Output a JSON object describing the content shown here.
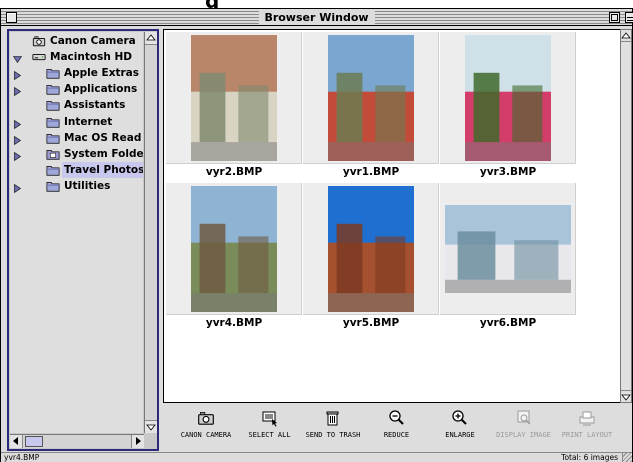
{
  "window": {
    "title": "Browser Window"
  },
  "tree": {
    "items": [
      {
        "label": "Canon Camera",
        "icon": "camera-icon",
        "expander": "none"
      },
      {
        "label": "Macintosh HD",
        "icon": "hard-disk-icon",
        "expander": "down"
      },
      {
        "label": "Apple Extras",
        "icon": "folder-icon",
        "expander": "right"
      },
      {
        "label": "Applications",
        "icon": "folder-icon",
        "expander": "right"
      },
      {
        "label": "Assistants",
        "icon": "folder-icon",
        "expander": "none"
      },
      {
        "label": "Internet",
        "icon": "folder-icon",
        "expander": "right"
      },
      {
        "label": "Mac OS Read Me",
        "icon": "folder-icon",
        "expander": "right"
      },
      {
        "label": "System Folder",
        "icon": "system-folder-icon",
        "expander": "right"
      },
      {
        "label": "Travel Photos",
        "icon": "folder-icon",
        "expander": "none",
        "selected": true
      },
      {
        "label": "Utilities",
        "icon": "folder-icon",
        "expander": "right"
      }
    ]
  },
  "gallery": {
    "thumbnails": [
      {
        "name": "vyr2.BMP",
        "orientation": "portrait",
        "palette": [
          "#b9866a",
          "#d9d3c4",
          "#7f8a6e"
        ]
      },
      {
        "name": "yvr1.BMP",
        "orientation": "portrait",
        "palette": [
          "#7aa6cf",
          "#c24b3a",
          "#6c7b52"
        ]
      },
      {
        "name": "yvr3.BMP",
        "orientation": "portrait",
        "palette": [
          "#cfe0e8",
          "#d23d6a",
          "#3f6a2c"
        ]
      },
      {
        "name": "yvr4.BMP",
        "orientation": "portrait",
        "palette": [
          "#8fb3d2",
          "#7a8c5a",
          "#6f5a42"
        ]
      },
      {
        "name": "yvr5.BMP",
        "orientation": "portrait",
        "palette": [
          "#1f6fd0",
          "#a5502f",
          "#7b3a22"
        ]
      },
      {
        "name": "yvr6.BMP",
        "orientation": "landscape",
        "palette": [
          "#a9c3d8",
          "#e8e8ec",
          "#6c8ea0"
        ]
      }
    ]
  },
  "toolbar": {
    "buttons": [
      {
        "label": "CANON CAMERA",
        "icon": "camera-icon",
        "enabled": true
      },
      {
        "label": "SELECT ALL",
        "icon": "select-all-icon",
        "enabled": true
      },
      {
        "label": "SEND TO TRASH",
        "icon": "trash-icon",
        "enabled": true
      },
      {
        "label": "REDUCE",
        "icon": "zoom-out-icon",
        "enabled": true
      },
      {
        "label": "ENLARGE",
        "icon": "zoom-in-icon",
        "enabled": true
      },
      {
        "label": "DISPLAY IMAGE",
        "icon": "display-image-icon",
        "enabled": false
      },
      {
        "label": "PRINT LAYOUT",
        "icon": "print-layout-icon",
        "enabled": false
      }
    ]
  },
  "status": {
    "selected_file": "yvr4.BMP",
    "total": "Total: 6 images"
  },
  "colors": {
    "selection": "#c8c8ee",
    "panel_border": "#2a2a7a",
    "chrome": "#dddddd"
  }
}
